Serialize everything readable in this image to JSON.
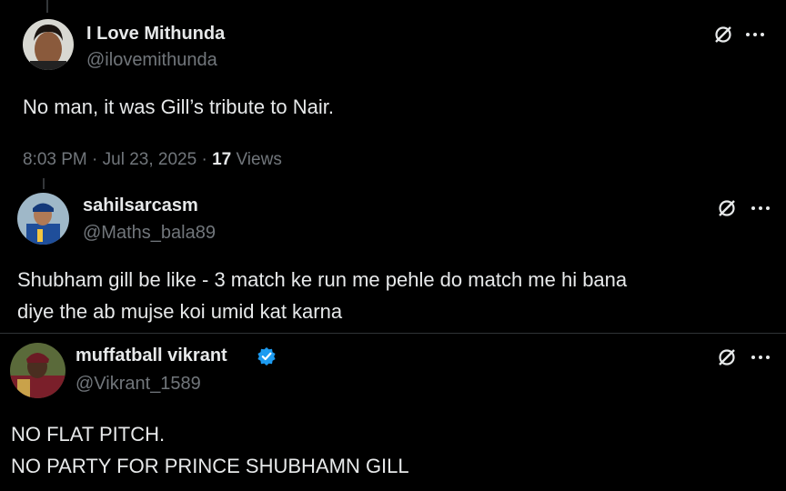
{
  "tweets": [
    {
      "name": "I Love Mithunda",
      "handle": "@ilovemithunda",
      "text_lines": [
        "No man, it was Gill’s tribute to Nair."
      ],
      "time": "8:03 PM · Jul 23, 2025 · ",
      "views_count": "17",
      "views_label": " Views",
      "verified": false
    },
    {
      "name": "sahilsarcasm",
      "handle": "@Maths_bala89",
      "text_lines": [
        "Shubham gill be like -  3 match ke run me pehle do match me hi bana",
        "diye the ab mujse koi umid kat karna"
      ],
      "verified": false
    },
    {
      "name": "muffatball vikrant",
      "handle": "@Vikrant_1589",
      "text_lines": [
        "NO FLAT PITCH.",
        "NO PARTY FOR PRINCE SHUBHAMN GILL"
      ],
      "verified": true
    }
  ],
  "icons": {
    "grok": "grok-icon",
    "more": "more-icon",
    "verified": "verified-badge-icon"
  },
  "colors": {
    "background": "#000000",
    "text": "#e7e9ea",
    "muted": "#71767b",
    "verified": "#1d9bf0",
    "divider": "#2f3336"
  }
}
